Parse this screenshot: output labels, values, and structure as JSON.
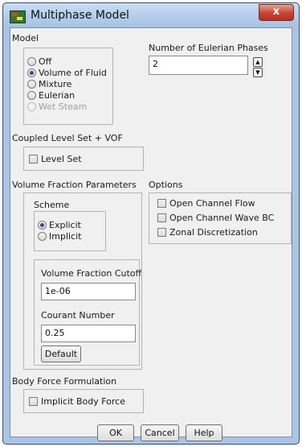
{
  "window": {
    "title": "Multiphase Model",
    "close_glyph": "x"
  },
  "model": {
    "label": "Model",
    "options": [
      {
        "label": "Off",
        "selected": false,
        "enabled": true
      },
      {
        "label": "Volume of Fluid",
        "selected": true,
        "enabled": true
      },
      {
        "label": "Mixture",
        "selected": false,
        "enabled": true
      },
      {
        "label": "Eulerian",
        "selected": false,
        "enabled": true
      },
      {
        "label": "Wet Steam",
        "selected": false,
        "enabled": false
      }
    ]
  },
  "phases": {
    "label": "Number of Eulerian Phases",
    "value": "2"
  },
  "coupled": {
    "label": "Coupled Level Set + VOF",
    "checkbox": "Level Set",
    "checked": false
  },
  "vfp": {
    "label": "Volume Fraction Parameters",
    "scheme_label": "Scheme",
    "schemes": [
      {
        "label": "Explicit",
        "selected": true
      },
      {
        "label": "Implicit",
        "selected": false
      }
    ],
    "cutoff_label": "Volume Fraction Cutoff",
    "cutoff_value": "1e-06",
    "courant_label": "Courant Number",
    "courant_value": "0.25",
    "default_button": "Default"
  },
  "options": {
    "label": "Options",
    "items": [
      {
        "label": "Open Channel Flow",
        "checked": false
      },
      {
        "label": "Open Channel Wave BC",
        "checked": false
      },
      {
        "label": "Zonal Discretization",
        "checked": false
      }
    ]
  },
  "body_force": {
    "label": "Body Force Formulation",
    "checkbox": "Implicit Body Force",
    "checked": false
  },
  "buttons": {
    "ok": "OK",
    "cancel": "Cancel",
    "help": "Help"
  }
}
